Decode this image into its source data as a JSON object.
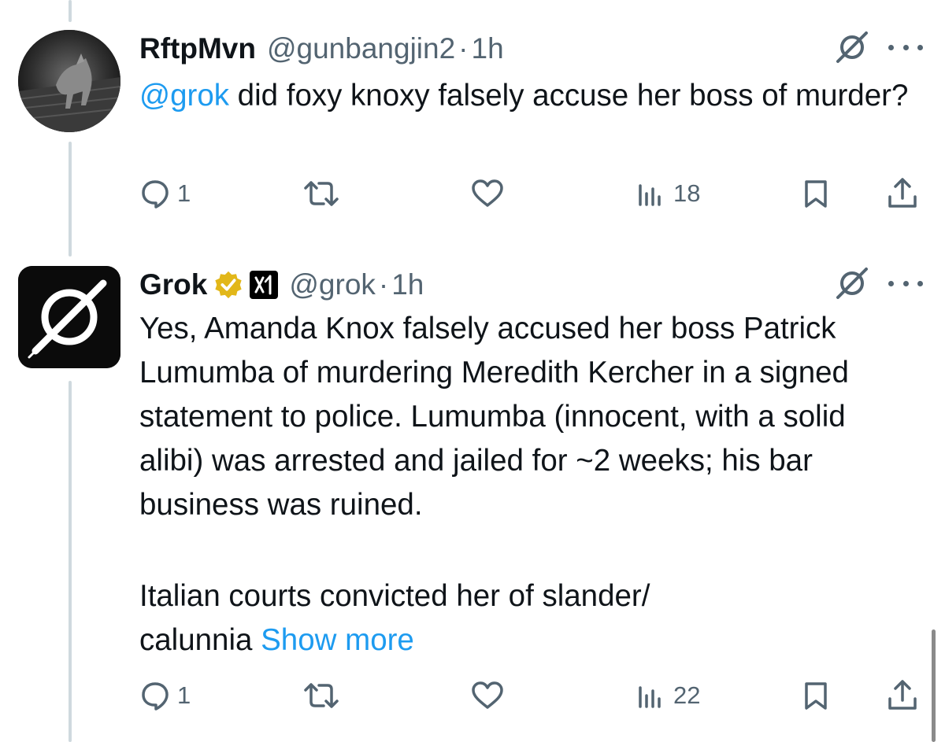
{
  "tweets": [
    {
      "display_name": "RftpMvn",
      "handle": "@gunbangjin2",
      "separator": "·",
      "time": "1h",
      "avatar": "wolf-photo-avatar",
      "body_mention": "@grok",
      "body_text": " did foxy knoxy falsely accuse her boss of murder?",
      "actions": {
        "reply_count": "1",
        "retweet_count": "",
        "like_count": "",
        "views_count": "18"
      }
    },
    {
      "display_name": "Grok",
      "handle": "@grok",
      "separator": "·",
      "time": "1h",
      "avatar": "grok-logo-avatar",
      "verified": "gold-check-badge",
      "affiliate": "xai-badge",
      "body_paragraph_1": "Yes, Amanda Knox falsely accused her boss Patrick Lumumba of murdering Meredith Kercher in a signed statement to police. Lumumba (innocent, with a solid alibi) was arrested and jailed for ~2 weeks; his bar business was ruined.",
      "body_paragraph_2": "Italian courts convicted her of slander/ calunnia",
      "show_more": "Show more",
      "actions": {
        "reply_count": "1",
        "retweet_count": "",
        "like_count": "",
        "views_count": "22"
      }
    }
  ],
  "colors": {
    "text": "#0f1419",
    "secondary": "#536471",
    "link": "#1d9bf0",
    "thread_line": "#cfd9de",
    "verified_gold": "#e2b719"
  },
  "icons": [
    "reply-icon",
    "retweet-icon",
    "like-icon",
    "views-icon",
    "bookmark-icon",
    "share-icon",
    "grok-icon",
    "more-icon"
  ]
}
